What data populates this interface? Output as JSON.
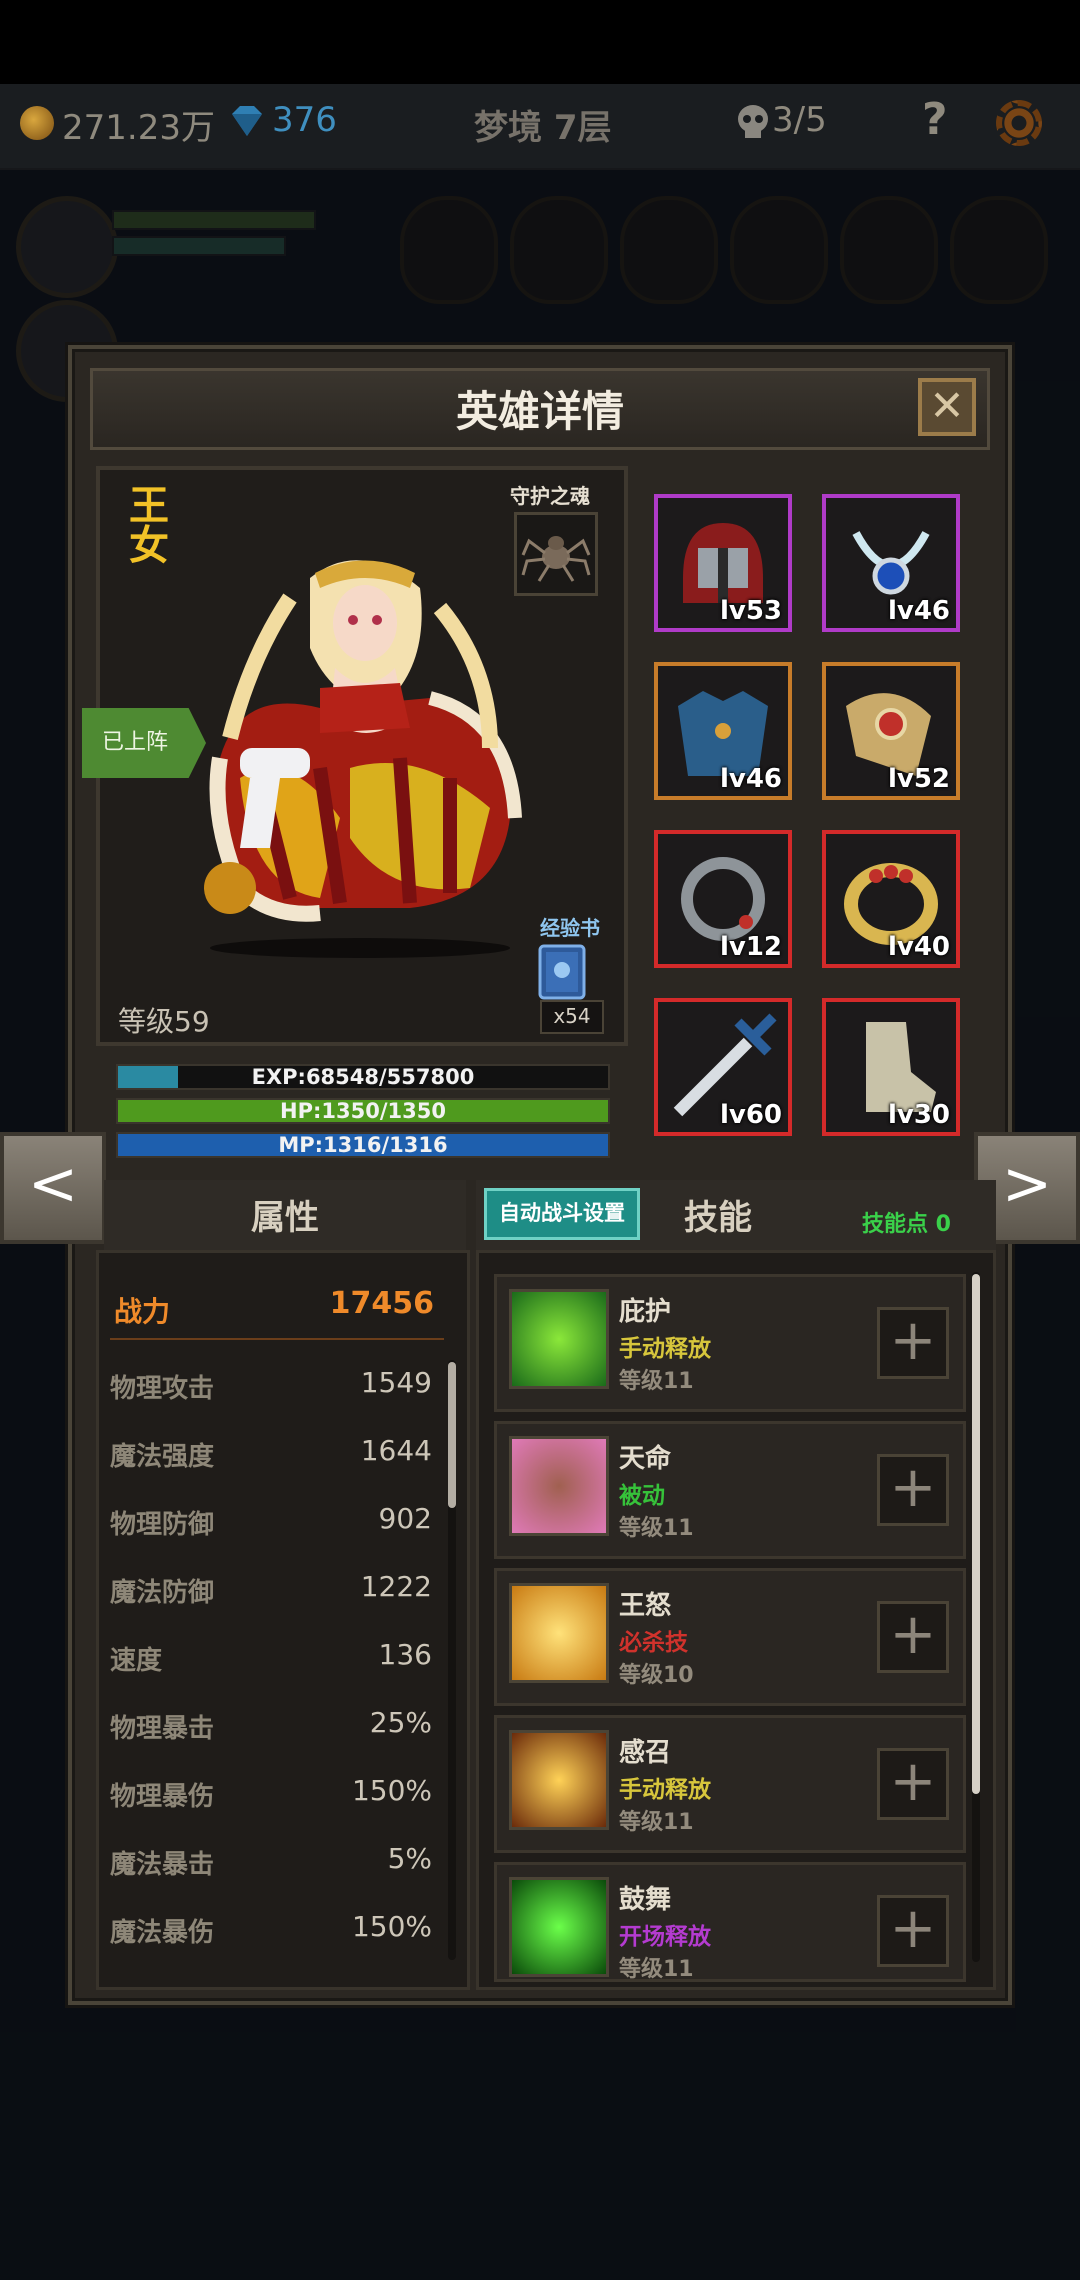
{
  "topbar": {
    "gold": "271.23万",
    "diamonds": "376",
    "location": "梦境 7层",
    "skull_count": "3/5",
    "help": "?"
  },
  "dialog": {
    "title": "英雄详情",
    "close": "✕"
  },
  "hero": {
    "name": "王女",
    "soul_label": "守护之魂",
    "deployed": "已上阵",
    "expbook_label": "经验书",
    "expbook_count": "x54",
    "level": "等级59",
    "exp": "EXP:68548/557800",
    "hp": "HP:1350/1350",
    "mp": "MP:1316/1316",
    "exp_fraction": 0.123,
    "hp_fraction": 1.0,
    "mp_fraction": 1.0
  },
  "equipment": [
    {
      "name": "helmet",
      "level": "lv53",
      "rarity_color": "#b03bc8"
    },
    {
      "name": "amulet",
      "level": "lv46",
      "rarity_color": "#b03bc8"
    },
    {
      "name": "armor",
      "level": "lv46",
      "rarity_color": "#c77c2a"
    },
    {
      "name": "shoulder",
      "level": "lv52",
      "rarity_color": "#c77c2a"
    },
    {
      "name": "bracelet",
      "level": "lv12",
      "rarity_color": "#d42a2a"
    },
    {
      "name": "ring",
      "level": "lv40",
      "rarity_color": "#d42a2a"
    },
    {
      "name": "sword",
      "level": "lv60",
      "rarity_color": "#d42a2a"
    },
    {
      "name": "boots",
      "level": "lv30",
      "rarity_color": "#d42a2a"
    }
  ],
  "nav": {
    "prev": "<",
    "next": ">"
  },
  "attributes": {
    "tab": "属性",
    "power_label": "战力",
    "power_value": "17456",
    "stats": [
      {
        "label": "物理攻击",
        "value": "1549"
      },
      {
        "label": "魔法强度",
        "value": "1644"
      },
      {
        "label": "物理防御",
        "value": "902"
      },
      {
        "label": "魔法防御",
        "value": "1222"
      },
      {
        "label": "速度",
        "value": "136"
      },
      {
        "label": "物理暴击",
        "value": "25%"
      },
      {
        "label": "物理暴伤",
        "value": "150%"
      },
      {
        "label": "魔法暴击",
        "value": "5%"
      },
      {
        "label": "魔法暴伤",
        "value": "150%"
      }
    ]
  },
  "skills": {
    "auto_button": "自动战斗设置",
    "tab": "技能",
    "points": "技能点 0",
    "list": [
      {
        "name": "庇护",
        "type": "手动释放",
        "type_color": "#d7c63c",
        "level": "等级11"
      },
      {
        "name": "天命",
        "type": "被动",
        "type_color": "#36c23a",
        "level": "等级11"
      },
      {
        "name": "王怒",
        "type": "必杀技",
        "type_color": "#d0322c",
        "level": "等级10"
      },
      {
        "name": "感召",
        "type": "手动释放",
        "type_color": "#d7c63c",
        "level": "等级11"
      },
      {
        "name": "鼓舞",
        "type": "开场释放",
        "type_color": "#b43bd0",
        "level": "等级11"
      }
    ],
    "plus": "+"
  }
}
